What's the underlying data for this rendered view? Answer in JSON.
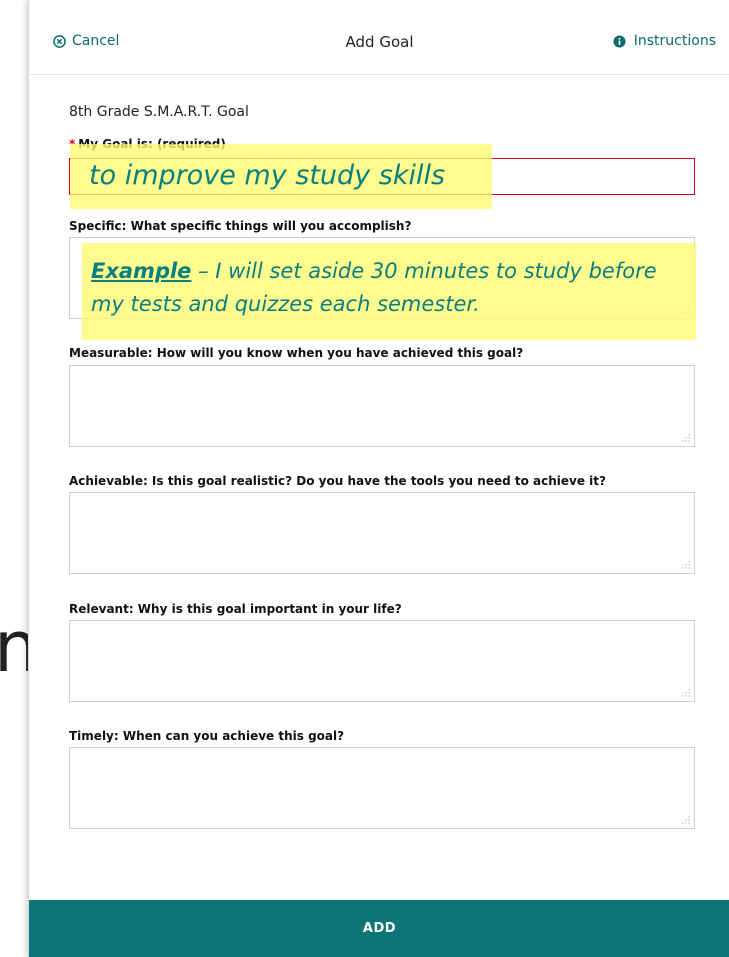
{
  "background": {
    "partial_glyph": "n"
  },
  "header": {
    "cancel_label": "Cancel",
    "title": "Add Goal",
    "instructions_label": "Instructions"
  },
  "form": {
    "section_title": "8th Grade S.M.A.R.T. Goal",
    "goal": {
      "required_star": "*",
      "label": "My Goal is: (required)",
      "value": "to improve my study skills"
    },
    "specific": {
      "label": "Specific: What specific things will you accomplish?",
      "example_word": "Example",
      "example_text": " – I will set aside 30 minutes to study before my tests and quizzes each semester."
    },
    "measurable": {
      "label": "Measurable: How will you know when you have achieved this goal?"
    },
    "achievable": {
      "label": "Achievable: Is this goal realistic? Do you have the tools you need to achieve it?"
    },
    "relevant": {
      "label": "Relevant: Why is this goal important in your life?"
    },
    "timely": {
      "label": "Timely: When can you achieve this goal?"
    }
  },
  "footer": {
    "add_label": "ADD"
  },
  "colors": {
    "accent": "#0b7474",
    "link": "#0b6b6e",
    "required": "#d0021b",
    "highlight": "#fffa6e",
    "annotation_text": "#0a7f7f"
  },
  "icons": {
    "cancel": "circle-x-icon",
    "instructions": "info-circle-icon",
    "resize": "resize-grip-icon"
  }
}
